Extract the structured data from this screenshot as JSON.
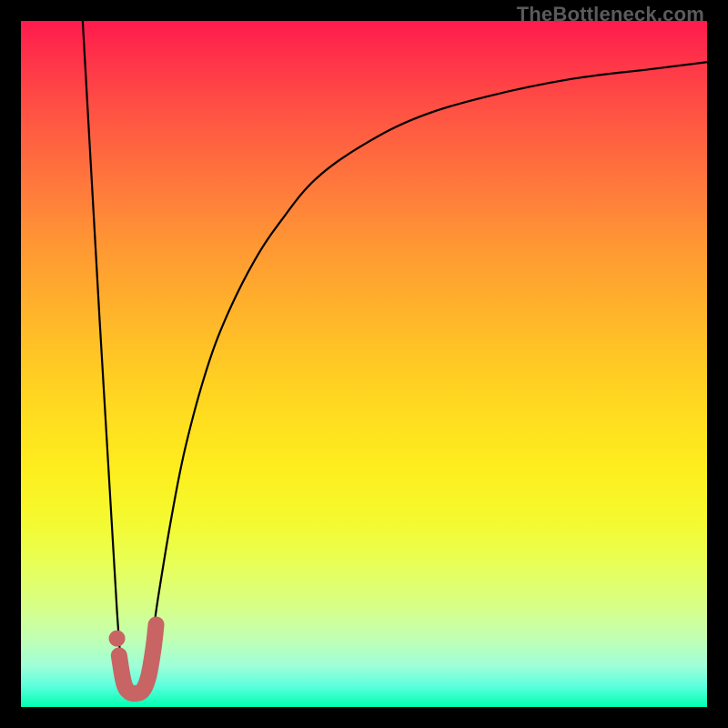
{
  "watermark": "TheBottleneck.com",
  "chart_data": {
    "type": "line",
    "title": "",
    "xlabel": "",
    "ylabel": "",
    "xlim": [
      0,
      100
    ],
    "ylim": [
      0,
      100
    ],
    "grid": false,
    "series": [
      {
        "name": "bottleneck-curve",
        "x": [
          9,
          14,
          15.5,
          17,
          18,
          19,
          20,
          22,
          24,
          27,
          30,
          34,
          38,
          43,
          50,
          58,
          68,
          80,
          92,
          100
        ],
        "y": [
          100,
          14,
          4,
          3,
          4,
          9,
          16,
          28,
          38,
          49,
          57,
          65,
          71,
          77,
          82,
          86,
          89,
          91.5,
          93,
          94
        ],
        "color": "#000000"
      },
      {
        "name": "highlight-region",
        "x": [
          14.3,
          15.0,
          15.8,
          16.8,
          17.8,
          18.6,
          19.3,
          19.7
        ],
        "y": [
          7.5,
          3.5,
          2.2,
          2.0,
          2.5,
          4.5,
          8.5,
          12.0
        ],
        "color": "#c86464"
      },
      {
        "name": "highlight-dot",
        "x": [
          14.0
        ],
        "y": [
          10.0
        ],
        "color": "#c86464"
      }
    ]
  }
}
